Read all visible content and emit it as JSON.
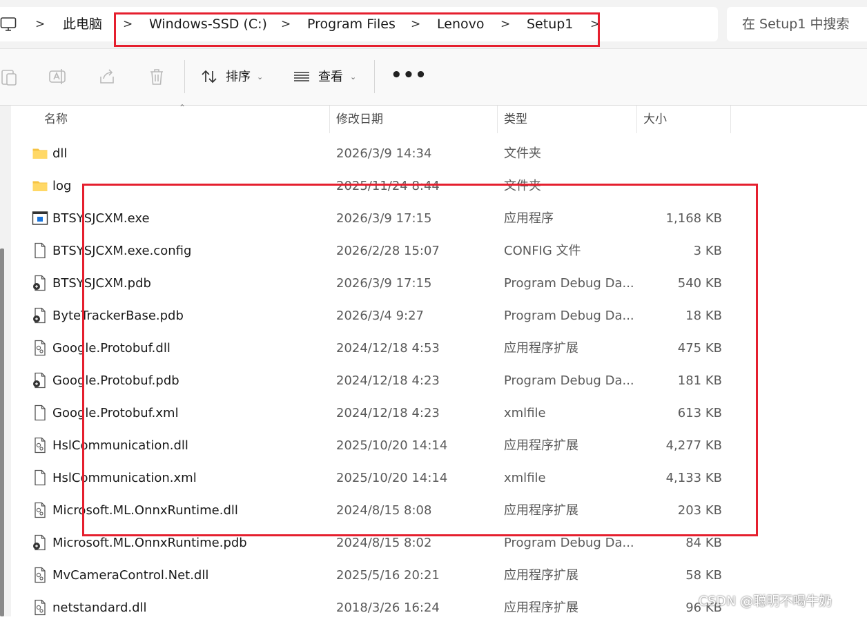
{
  "address": {
    "crumbs": [
      "此电脑",
      "Windows-SSD (C:)",
      "Program Files",
      "Lenovo",
      "Setup1"
    ],
    "search_placeholder": "在 Setup1 中搜索"
  },
  "toolbar": {
    "sort_label": "排序",
    "view_label": "查看",
    "more_label": "•••"
  },
  "columns": {
    "name": "名称",
    "date": "修改日期",
    "type": "类型",
    "size": "大小"
  },
  "files": [
    {
      "name": "dll",
      "date": "2026/3/9 14:34",
      "type": "文件夹",
      "size": "",
      "icon": "folder-icon"
    },
    {
      "name": "log",
      "date": "2025/11/24 8:44",
      "type": "文件夹",
      "size": "",
      "icon": "folder-icon"
    },
    {
      "name": "BTSYSJCXM.exe",
      "date": "2026/3/9 17:15",
      "type": "应用程序",
      "size": "1,168 KB",
      "icon": "exe-icon"
    },
    {
      "name": "BTSYSJCXM.exe.config",
      "date": "2026/2/28 15:07",
      "type": "CONFIG 文件",
      "size": "3 KB",
      "icon": "file-icon"
    },
    {
      "name": "BTSYSJCXM.pdb",
      "date": "2026/3/9 17:15",
      "type": "Program Debug Da...",
      "size": "540 KB",
      "icon": "pdb-icon"
    },
    {
      "name": "ByteTrackerBase.pdb",
      "date": "2026/3/4 9:27",
      "type": "Program Debug Da...",
      "size": "18 KB",
      "icon": "pdb-icon"
    },
    {
      "name": "Google.Protobuf.dll",
      "date": "2024/12/18 4:53",
      "type": "应用程序扩展",
      "size": "475 KB",
      "icon": "dll-icon"
    },
    {
      "name": "Google.Protobuf.pdb",
      "date": "2024/12/18 4:23",
      "type": "Program Debug Da...",
      "size": "181 KB",
      "icon": "pdb-icon"
    },
    {
      "name": "Google.Protobuf.xml",
      "date": "2024/12/18 4:23",
      "type": "xmlfile",
      "size": "613 KB",
      "icon": "file-icon"
    },
    {
      "name": "HslCommunication.dll",
      "date": "2025/10/20 14:14",
      "type": "应用程序扩展",
      "size": "4,277 KB",
      "icon": "dll-icon"
    },
    {
      "name": "HslCommunication.xml",
      "date": "2025/10/20 14:14",
      "type": "xmlfile",
      "size": "4,133 KB",
      "icon": "file-icon"
    },
    {
      "name": "Microsoft.ML.OnnxRuntime.dll",
      "date": "2024/8/15 8:08",
      "type": "应用程序扩展",
      "size": "203 KB",
      "icon": "dll-icon"
    },
    {
      "name": "Microsoft.ML.OnnxRuntime.pdb",
      "date": "2024/8/15 8:02",
      "type": "Program Debug Da...",
      "size": "84 KB",
      "icon": "pdb-icon"
    },
    {
      "name": "MvCameraControl.Net.dll",
      "date": "2025/5/16 20:21",
      "type": "应用程序扩展",
      "size": "58 KB",
      "icon": "dll-icon"
    },
    {
      "name": "netstandard.dll",
      "date": "2018/3/26 16:24",
      "type": "应用程序扩展",
      "size": "96 KB",
      "icon": "dll-icon"
    }
  ],
  "watermark": "CSDN @聪明不喝牛奶",
  "colors": {
    "highlight": "#e51f2e",
    "folder": "#f6c343",
    "exe_accent": "#1a73d9"
  }
}
